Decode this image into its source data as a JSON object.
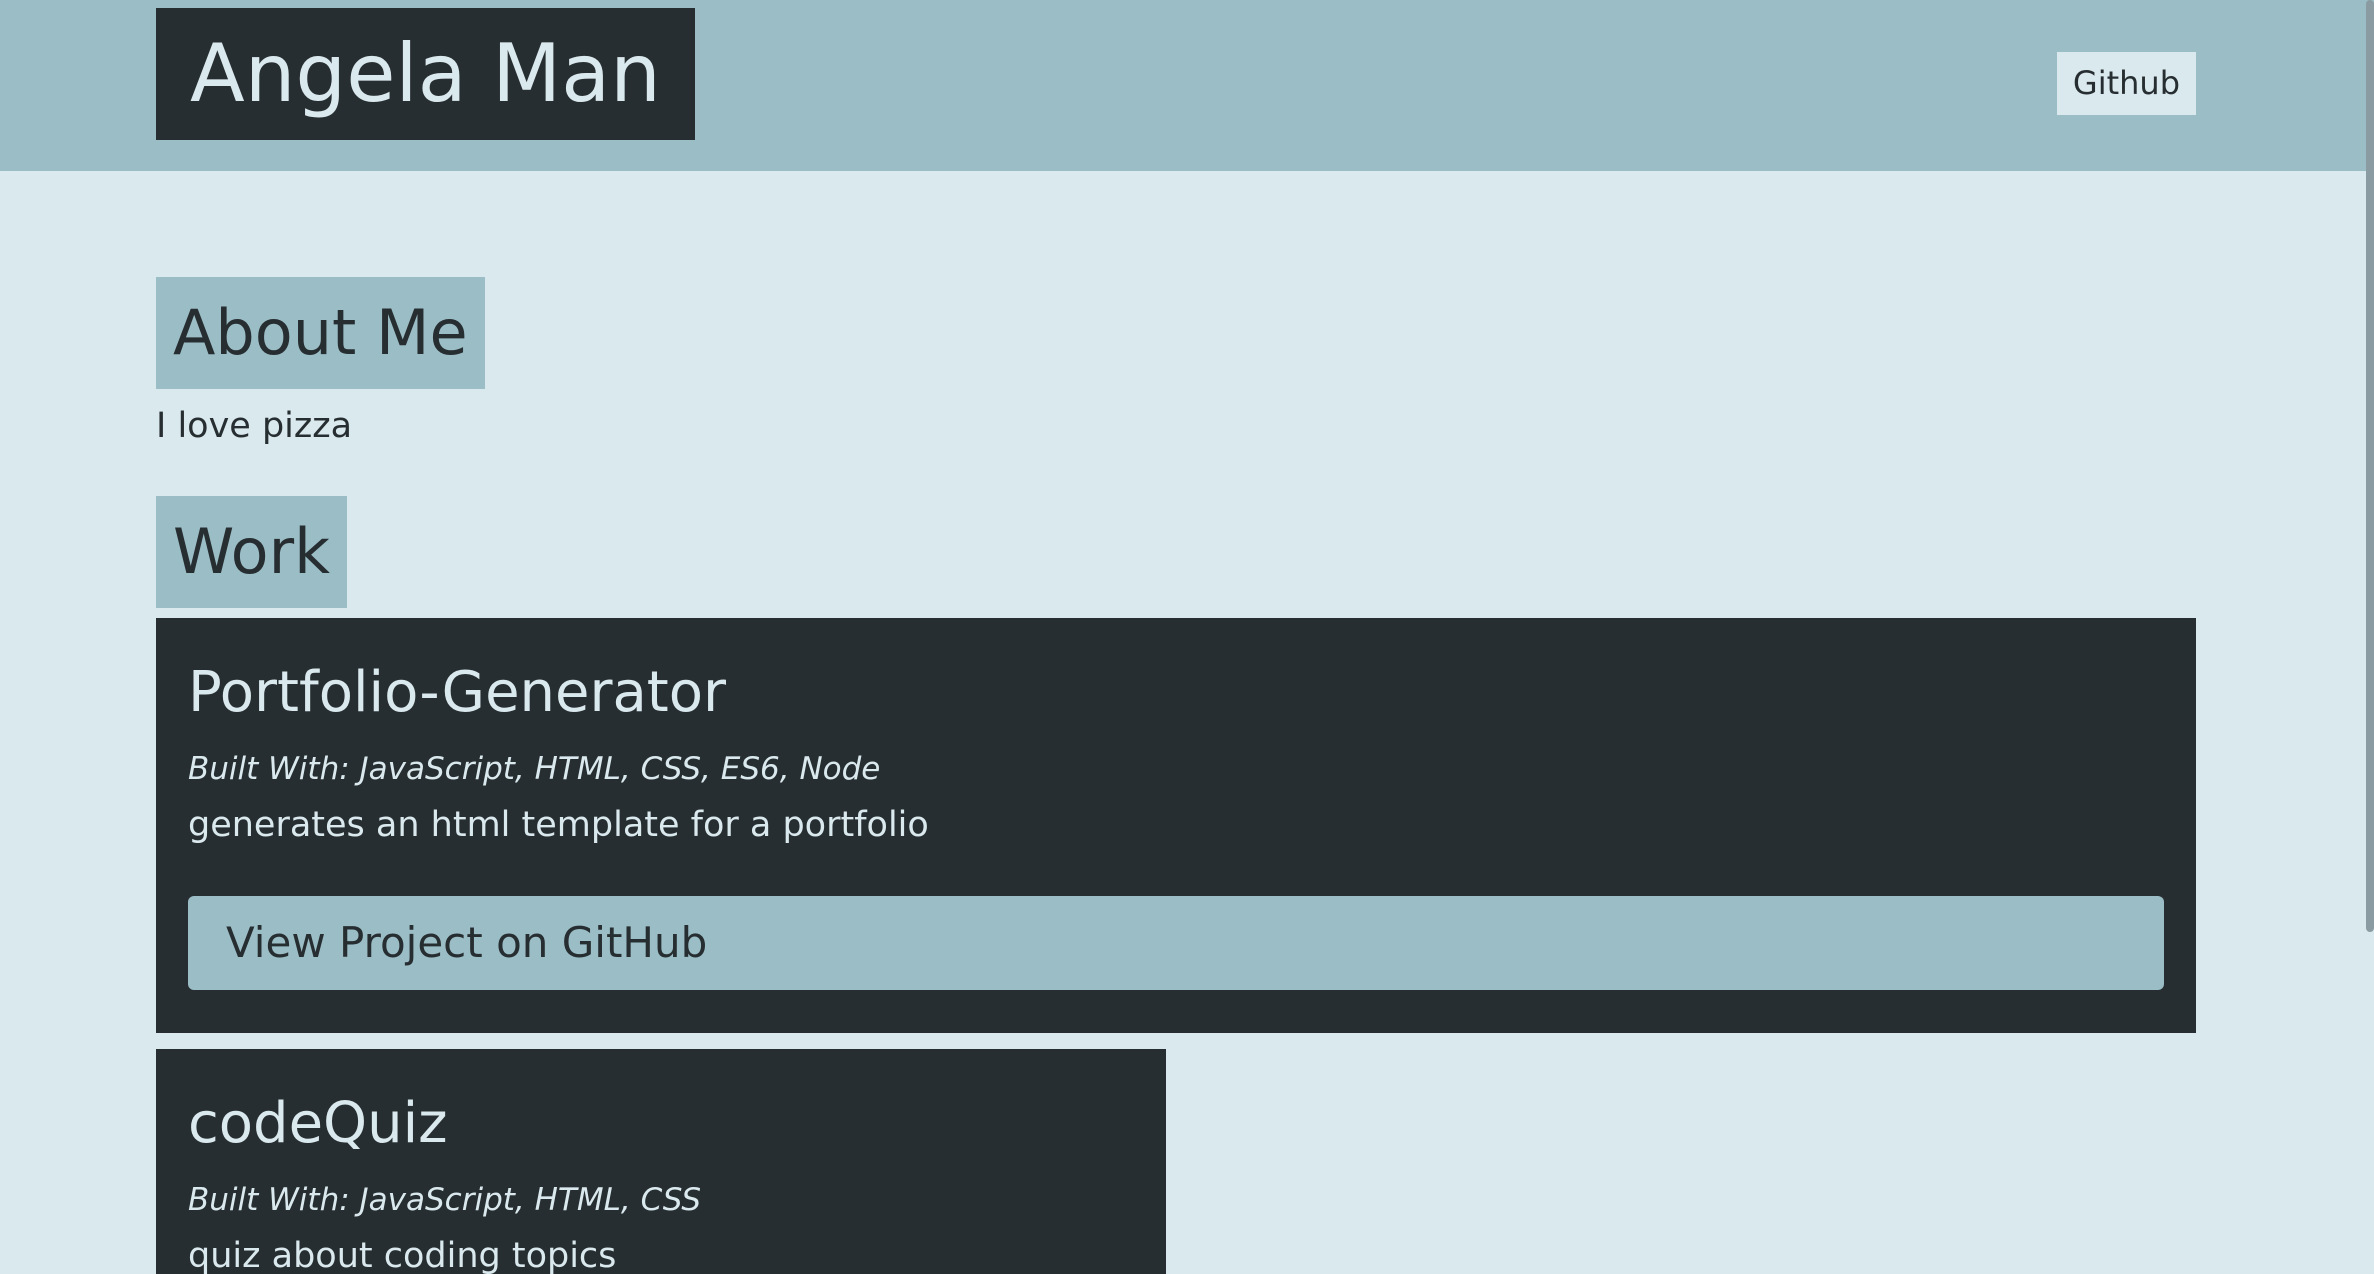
{
  "header": {
    "brand": "Angela Man",
    "nav_link": "Github"
  },
  "about": {
    "heading": "About Me",
    "text": "I love pizza"
  },
  "work": {
    "heading": "Work",
    "projects": [
      {
        "title": "Portfolio-Generator",
        "tech": "Built With: JavaScript, HTML, CSS, ES6, Node",
        "description": "generates an html template for a portfolio",
        "button_label": "View Project on GitHub"
      },
      {
        "title": "codeQuiz",
        "tech": "Built With: JavaScript, HTML, CSS",
        "description": "quiz about coding topics"
      }
    ]
  },
  "colors": {
    "background": "#dae9ee",
    "accent": "#9bbdc6",
    "dark": "#272e31"
  }
}
